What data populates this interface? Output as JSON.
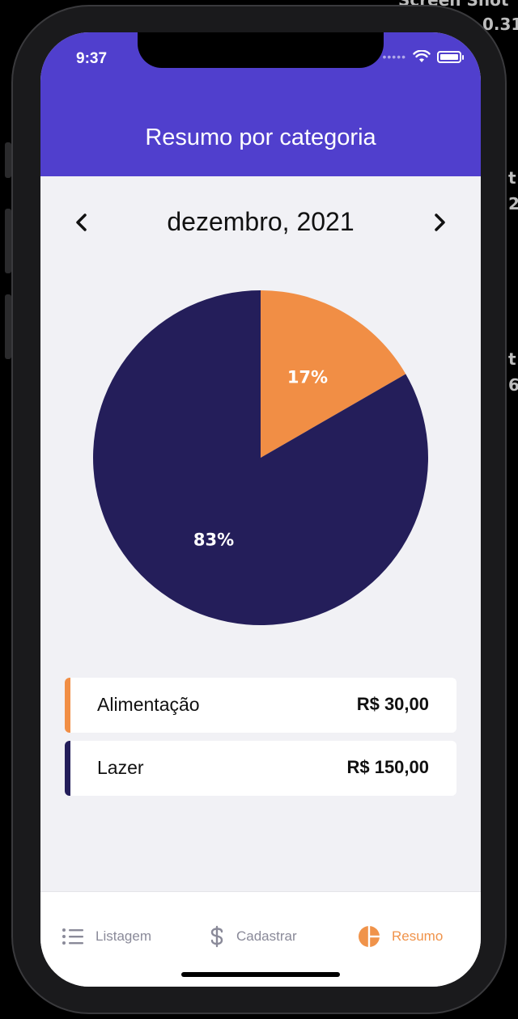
{
  "background_text": {
    "top": "Screen Shot",
    "top2": "0.31",
    "right1": "t",
    "right2": "2",
    "right3": "t",
    "right4": "6"
  },
  "status_bar": {
    "time": "9:37"
  },
  "header": {
    "title": "Resumo por categoria"
  },
  "month_nav": {
    "label": "dezembro, 2021",
    "prev_icon": "chevron-left-icon",
    "next_icon": "chevron-right-icon"
  },
  "chart_data": {
    "type": "pie",
    "slices": [
      {
        "label": "Alimentação",
        "value": 30,
        "percent_label": "17%",
        "color": "#f18e45"
      },
      {
        "label": "Lazer",
        "value": 150,
        "percent_label": "83%",
        "color": "#241e5a"
      }
    ]
  },
  "legend": [
    {
      "name": "Alimentação",
      "amount": "R$ 30,00",
      "color": "#f18e45"
    },
    {
      "name": "Lazer",
      "amount": "R$ 150,00",
      "color": "#241e5a"
    }
  ],
  "tabs": [
    {
      "label": "Listagem",
      "icon": "list-icon",
      "active": false
    },
    {
      "label": "Cadastrar",
      "icon": "dollar-icon",
      "active": false
    },
    {
      "label": "Resumo",
      "icon": "pie-chart-icon",
      "active": true
    }
  ],
  "colors": {
    "header": "#503fcd",
    "accent": "#f0934a",
    "background": "#f1f1f5"
  }
}
